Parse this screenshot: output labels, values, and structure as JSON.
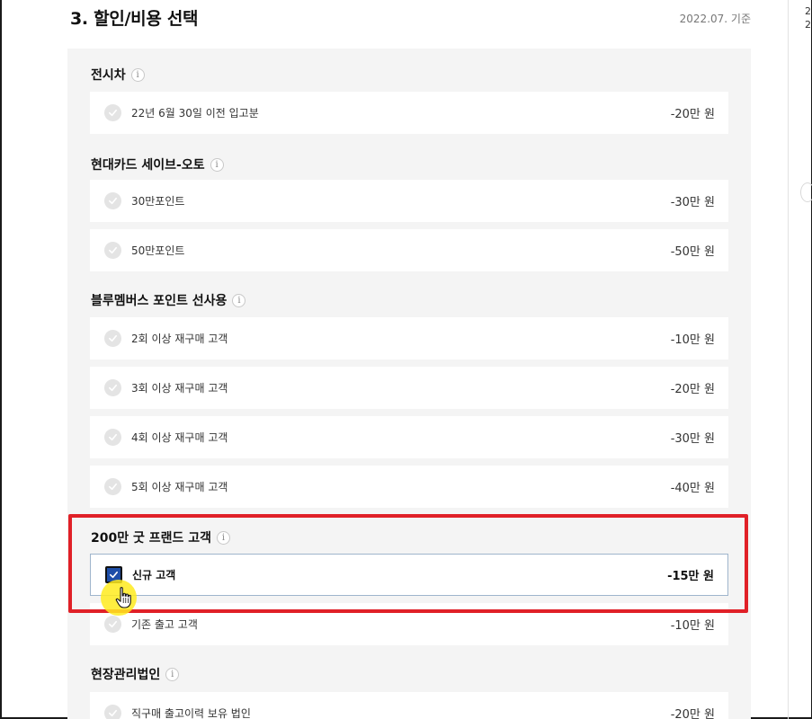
{
  "header": {
    "title": "3. 할인/비용 선택",
    "date": "2022.07. 기준"
  },
  "right_snippets": [
    "2",
    "2"
  ],
  "groups": [
    {
      "title": "전시차",
      "options": [
        {
          "label": "22년 6월 30일 이전 입고분",
          "price": "-20만 원",
          "selected": false
        }
      ]
    },
    {
      "title": "현대카드 세이브-오토",
      "options": [
        {
          "label": "30만포인트",
          "price": "-30만 원",
          "selected": false
        },
        {
          "label": "50만포인트",
          "price": "-50만 원",
          "selected": false
        }
      ]
    },
    {
      "title": "블루멤버스 포인트 선사용",
      "options": [
        {
          "label": "2회 이상 재구매 고객",
          "price": "-10만 원",
          "selected": false
        },
        {
          "label": "3회 이상 재구매 고객",
          "price": "-20만 원",
          "selected": false
        },
        {
          "label": "4회 이상 재구매 고객",
          "price": "-30만 원",
          "selected": false
        },
        {
          "label": "5회 이상 재구매 고객",
          "price": "-40만 원",
          "selected": false
        }
      ]
    },
    {
      "title": "200만 굿 프랜드 고객",
      "options": [
        {
          "label": "신규 고객",
          "price": "-15만 원",
          "selected": true
        },
        {
          "label": "기존 출고 고객",
          "price": "-10만 원",
          "selected": false
        }
      ]
    },
    {
      "title": "현장관리법인",
      "options": [
        {
          "label": "직구매 출고이력 보유 법인",
          "price": "-20만 원",
          "selected": false
        }
      ]
    }
  ],
  "info_icon_glyph": "i",
  "colors": {
    "panel_bg": "#f4f4f4",
    "selected_check": "#1e4ea8",
    "highlight": "#e02027",
    "cursor_glow": "#ffeb1e"
  }
}
